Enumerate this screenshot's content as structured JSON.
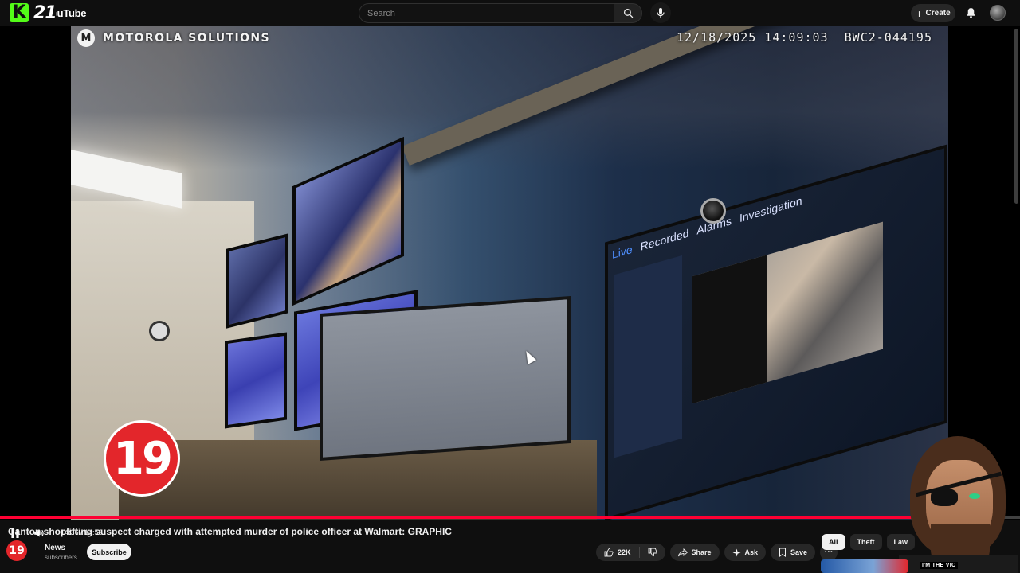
{
  "header": {
    "logo_k": "K",
    "logo_number": "21",
    "logo_word": "YouTube",
    "search_placeholder": "Search",
    "create_label": "Create"
  },
  "video": {
    "overlay_brand": "MOTOROLA SOLUTIONS",
    "overlay_timestamp": "12/18/2025 14:09:03",
    "overlay_device_id": "BWC2-044195",
    "channel_badge": "19",
    "screen_tabs": [
      "Live",
      "Recorded",
      "Alarms",
      "Investigation"
    ],
    "elapsed": "14:36",
    "duration": "14:59",
    "progress_fraction": 0.9744,
    "streamer_shirt_text": "I'M THE VIC"
  },
  "below": {
    "title": "Canton shoplifting suspect charged with attempted murder of police officer at Walmart: GRAPHIC",
    "channel_name": "News",
    "channel_subs": "subscribers",
    "subscribe_label": "Subscribe",
    "like_count": "22K",
    "share_label": "Share",
    "ask_label": "Ask",
    "save_label": "Save"
  },
  "chips": [
    "All",
    "Theft",
    "Law"
  ],
  "colors": {
    "accent_red": "#ff0033",
    "kick_green": "#53fc18",
    "badge_red": "#e3262b"
  }
}
